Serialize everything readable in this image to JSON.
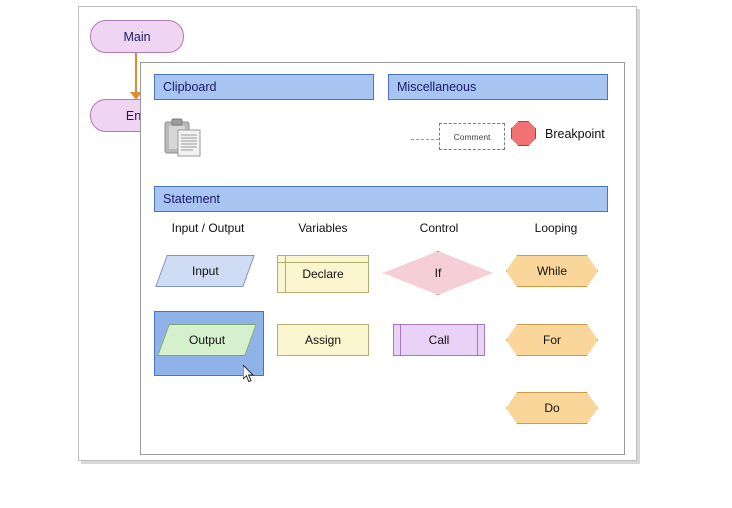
{
  "flowchart": {
    "main_label": "Main",
    "end_label": "End",
    "connector": "arrow-down"
  },
  "panel": {
    "sections": {
      "clipboard": {
        "title": "Clipboard",
        "icon": "clipboard-icon"
      },
      "miscellaneous": {
        "title": "Miscellaneous",
        "comment_label": "Comment",
        "breakpoint_label": "Breakpoint"
      },
      "statement": {
        "title": "Statement",
        "columns": [
          {
            "header": "Input / Output"
          },
          {
            "header": "Variables"
          },
          {
            "header": "Control"
          },
          {
            "header": "Looping"
          }
        ],
        "shapes": {
          "input": "Input",
          "output": "Output",
          "declare": "Declare",
          "assign": "Assign",
          "if": "If",
          "call": "Call",
          "while": "While",
          "for": "For",
          "do": "Do"
        },
        "selected_shape": "Output"
      }
    }
  },
  "colors": {
    "section_header_bg": "#a8c4f0",
    "section_header_border": "#4a72c4",
    "terminator_fill": "#f0d5f2",
    "terminator_border": "#b07ab5",
    "connector": "#e08a32",
    "input_fill": "#cfdcf3",
    "output_fill": "#d5f0cd",
    "variables_fill": "#fbf5d0",
    "control_if_fill": "#f5ced6",
    "control_call_fill": "#e8d2f5",
    "looping_fill": "#fad69a",
    "breakpoint_fill": "#f07272",
    "selection_fill": "#8fb3e8"
  }
}
